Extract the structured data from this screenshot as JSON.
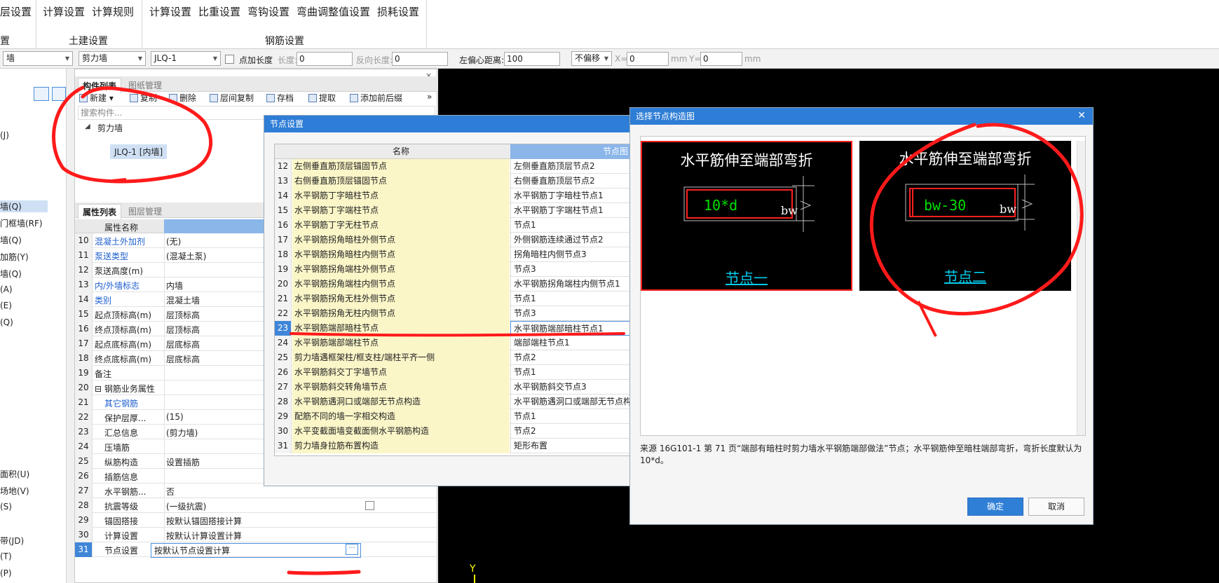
{
  "ribbon": {
    "items": [
      "层设置",
      "计算设置",
      "计算规则",
      "计算设置",
      "比重设置",
      "弯钩设置",
      "弯曲调整值设置",
      "损耗设置"
    ],
    "groups": [
      "置",
      "土建设置",
      "钢筋设置"
    ]
  },
  "toolbar": {
    "sel_type": "墙",
    "sel_sub": "剪力墙",
    "sel_comp": "JLQ-1",
    "pt_len_label": "点加长度",
    "len_label": "长度:",
    "len_value": "0",
    "rev_len_label": "反向长度:",
    "rev_len_value": "0",
    "offset_label": "左偏心距离:",
    "offset_value": "100",
    "nooff": "不偏移",
    "x_label": "X=",
    "x_value": "0",
    "y_label": "Y=",
    "y_value": "0",
    "unit": "mm"
  },
  "left": {
    "items": [
      "(J)",
      "墙(Q)",
      "门框墙(RF)",
      "墙(Q)",
      "加筋(Y)",
      "墙(Q)",
      "(A)",
      "(E)",
      "(Q)",
      "面积(U)",
      "场地(V)",
      "(S)",
      "带(JD)",
      "(T)",
      "(P)"
    ]
  },
  "comp_panel": {
    "tab1": "构件列表",
    "tab2": "图纸管理",
    "btn_new": "新建",
    "btn_copy": "复制",
    "btn_del": "删除",
    "btn_floor_copy": "层间复制",
    "btn_save": "存档",
    "btn_extract": "提取",
    "btn_add": "添加前后缀",
    "search_placeholder": "搜索构件...",
    "tree_root": "剪力墙",
    "tree_child": "JLQ-1 [内墙]"
  },
  "prop_panel": {
    "tab1": "属性列表",
    "tab2": "图层管理",
    "col_name": "属性名称",
    "rows": [
      {
        "n": "10",
        "k": "混凝土外加剂",
        "v": "(无)",
        "blue": true
      },
      {
        "n": "11",
        "k": "泵送类型",
        "v": "(混凝土泵)",
        "blue": true
      },
      {
        "n": "12",
        "k": "泵送高度(m)",
        "v": ""
      },
      {
        "n": "13",
        "k": "内/外墙标志",
        "v": "内墙",
        "blue": true
      },
      {
        "n": "14",
        "k": "类别",
        "v": "混凝土墙",
        "blue": true
      },
      {
        "n": "15",
        "k": "起点顶标高(m)",
        "v": "层顶标高"
      },
      {
        "n": "16",
        "k": "终点顶标高(m)",
        "v": "层顶标高"
      },
      {
        "n": "17",
        "k": "起点底标高(m)",
        "v": "层底标高"
      },
      {
        "n": "18",
        "k": "终点底标高(m)",
        "v": "层底标高"
      },
      {
        "n": "19",
        "k": "备注",
        "v": ""
      },
      {
        "n": "20",
        "k": "钢筋业务属性",
        "v": "",
        "group": true
      },
      {
        "n": "21",
        "k": "其它钢筋",
        "v": "",
        "blue": true,
        "indent": true
      },
      {
        "n": "22",
        "k": "保护层厚...",
        "v": "(15)",
        "indent": true
      },
      {
        "n": "23",
        "k": "汇总信息",
        "v": "(剪力墙)",
        "indent": true
      },
      {
        "n": "24",
        "k": "压墙筋",
        "v": "",
        "indent": true
      },
      {
        "n": "25",
        "k": "纵筋构造",
        "v": "设置插筋",
        "indent": true
      },
      {
        "n": "26",
        "k": "插筋信息",
        "v": "",
        "indent": true,
        "chk": true
      },
      {
        "n": "27",
        "k": "水平钢筋...",
        "v": "否",
        "indent": true
      },
      {
        "n": "28",
        "k": "抗震等级",
        "v": "(一级抗震)",
        "indent": true,
        "chk": true
      },
      {
        "n": "29",
        "k": "锚固搭接",
        "v": "按默认锚固搭接计算",
        "indent": true
      },
      {
        "n": "30",
        "k": "计算设置",
        "v": "按默认计算设置计算",
        "indent": true
      },
      {
        "n": "31",
        "k": "节点设置",
        "v": "按默认节点设置计算",
        "indent": true,
        "sel": true
      }
    ]
  },
  "node_dialog": {
    "title": "节点设置",
    "col_name": "名称",
    "col_node": "节点图",
    "rows": [
      {
        "n": "12",
        "name": "左侧垂直筋顶层锚固节点",
        "val": "左侧垂直筋顶层节点2"
      },
      {
        "n": "13",
        "name": "右侧垂直筋顶层锚固节点",
        "val": "右侧垂直筋顶层节点2"
      },
      {
        "n": "14",
        "name": "水平钢筋丁字暗柱节点",
        "val": "水平钢筋丁字暗柱节点1"
      },
      {
        "n": "15",
        "name": "水平钢筋丁字端柱节点",
        "val": "水平钢筋丁字端柱节点1"
      },
      {
        "n": "16",
        "name": "水平钢筋丁字无柱节点",
        "val": "节点1"
      },
      {
        "n": "17",
        "name": "水平钢筋拐角暗柱外侧节点",
        "val": "外侧钢筋连续通过节点2"
      },
      {
        "n": "18",
        "name": "水平钢筋拐角暗柱内侧节点",
        "val": "拐角暗柱内侧节点3"
      },
      {
        "n": "19",
        "name": "水平钢筋拐角端柱外侧节点",
        "val": "节点3"
      },
      {
        "n": "20",
        "name": "水平钢筋拐角端柱内侧节点",
        "val": "水平钢筋拐角端柱内侧节点1"
      },
      {
        "n": "21",
        "name": "水平钢筋拐角无柱外侧节点",
        "val": "节点1"
      },
      {
        "n": "22",
        "name": "水平钢筋拐角无柱内侧节点",
        "val": "节点3"
      },
      {
        "n": "23",
        "name": "水平钢筋端部暗柱节点",
        "val": "水平钢筋端部暗柱节点1",
        "sel": true
      },
      {
        "n": "24",
        "name": "水平钢筋端部端柱节点",
        "val": "端部端柱节点1"
      },
      {
        "n": "25",
        "name": "剪力墙遇框架柱/框支柱/端柱平齐一侧",
        "val": "节点2"
      },
      {
        "n": "26",
        "name": "水平钢筋斜交丁字墙节点",
        "val": "节点1"
      },
      {
        "n": "27",
        "name": "水平钢筋斜交转角墙节点",
        "val": "水平钢筋斜交节点3"
      },
      {
        "n": "28",
        "name": "水平钢筋遇洞口或端部无节点构造",
        "val": "水平钢筋遇洞口或端部无节点构造"
      },
      {
        "n": "29",
        "name": "配筋不同的墙一字相交构造",
        "val": "节点1"
      },
      {
        "n": "30",
        "name": "水平变截面墙变截面侧水平钢筋构造",
        "val": "节点2"
      },
      {
        "n": "31",
        "name": "剪力墙身拉筋布置构造",
        "val": "矩形布置"
      }
    ]
  },
  "select_dialog": {
    "title": "选择节点构造图",
    "pane1_title": "水平筋伸至端部弯折",
    "pane1_dim": "10*d",
    "pane1_bw": "bw",
    "pane1_link": "节点一",
    "pane2_title": "水平筋伸至端部弯折",
    "pane2_dim": "bw-30",
    "pane2_bw": "bw",
    "pane2_link": "节点二",
    "desc": "来源 16G101-1 第 71 页“端部有暗柱时剪力墙水平钢筋端部做法”节点；水平钢筋伸至暗柱端部弯折，弯折长度默认为 10*d。",
    "ok": "确定",
    "cancel": "取消"
  },
  "canvas": {
    "axis_label": "Y"
  },
  "colors": {
    "title_bar": "#2e7dd6",
    "highlight_red": "#ff1a1a",
    "name_bg": "#fbf6c8"
  }
}
